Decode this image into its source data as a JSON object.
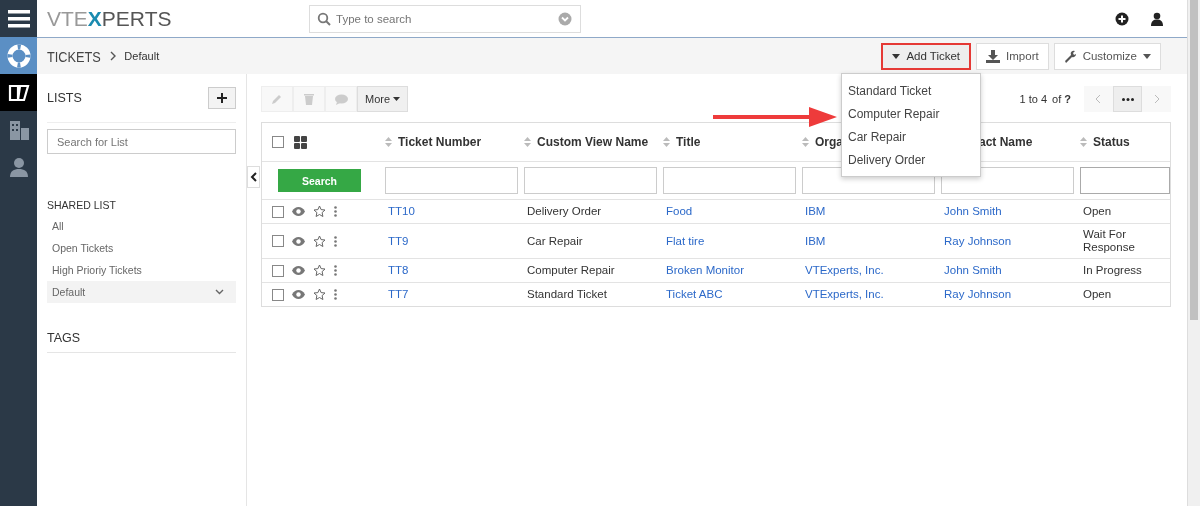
{
  "brand": {
    "logo_left": "VTE",
    "logo_x": "X",
    "logo_right": "PERTS"
  },
  "search": {
    "placeholder": "Type to search"
  },
  "rail": [
    {
      "kind": "menu",
      "selected": false
    },
    {
      "kind": "support",
      "selected": false
    },
    {
      "kind": "tickets",
      "selected": true
    },
    {
      "kind": "organizations",
      "selected": false
    },
    {
      "kind": "contacts",
      "selected": false
    }
  ],
  "breadcrumb": {
    "module": "TICKETS",
    "view": "Default"
  },
  "header_buttons": [
    {
      "kind": "add",
      "label": "Add Ticket",
      "highlighted": true
    },
    {
      "kind": "import",
      "label": "Import",
      "highlighted": false
    },
    {
      "kind": "customize",
      "label": "Customize",
      "highlighted": false
    }
  ],
  "add_menu": [
    "Standard Ticket",
    "Computer Repair",
    "Car Repair",
    "Delivery Order"
  ],
  "sidebar": {
    "lists_title": "LISTS",
    "search_placeholder": "Search for List",
    "shared_title": "SHARED LIST",
    "items": [
      {
        "label": "All",
        "selected": false
      },
      {
        "label": "Open Tickets",
        "selected": false
      },
      {
        "label": "High Prioriy Tickets",
        "selected": false
      },
      {
        "label": "Default",
        "selected": true
      }
    ],
    "tags_title": "TAGS"
  },
  "toolbar": {
    "more": "More",
    "pagination": "1 to 4",
    "of": "of",
    "total": "?"
  },
  "table": {
    "search_button": "Search",
    "columns": [
      {
        "label": "Ticket Number",
        "link": true,
        "covered": false
      },
      {
        "label": "Custom View Name",
        "link": false,
        "covered": false
      },
      {
        "label": "Title",
        "link": true,
        "covered": false
      },
      {
        "label": "Orga",
        "link": true,
        "covered": false
      },
      {
        "label": "act Name",
        "link": true,
        "covered": true
      },
      {
        "label": "Status",
        "link": false
      }
    ],
    "select_all_checked": false,
    "rows": [
      {
        "checked": false,
        "cells": [
          "TT10",
          "Delivery Order",
          "Food",
          "IBM",
          "John Smith",
          "Open"
        ]
      },
      {
        "checked": false,
        "cells": [
          "TT9",
          "Car Repair",
          "Flat tire",
          "IBM",
          "Ray Johnson",
          "Wait For Response"
        ]
      },
      {
        "checked": false,
        "cells": [
          "TT8",
          "Computer Repair",
          "Broken Monitor",
          "VTExperts, Inc.",
          "John Smith",
          "In Progress"
        ]
      },
      {
        "checked": false,
        "cells": [
          "TT7",
          "Standard Ticket",
          "Ticket ABC",
          "VTExperts, Inc.",
          "Ray Johnson",
          "Open"
        ]
      }
    ]
  }
}
